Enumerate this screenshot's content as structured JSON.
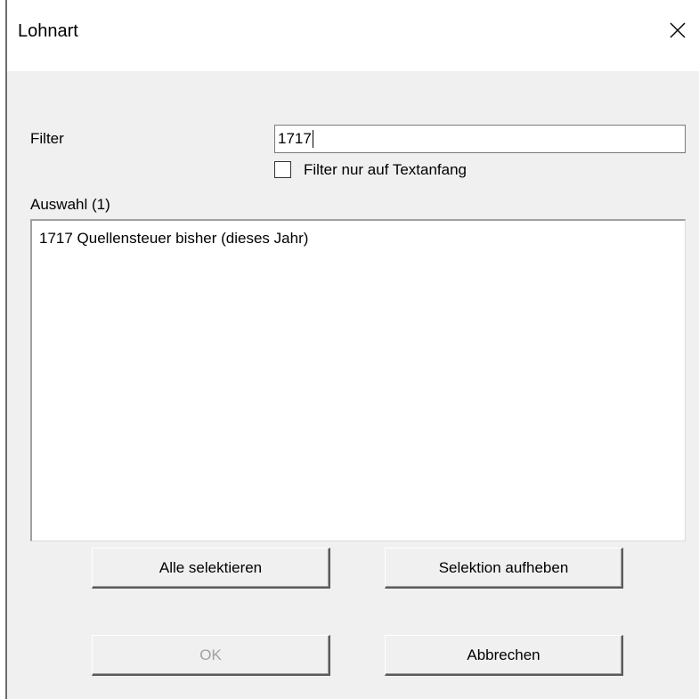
{
  "window": {
    "title": "Lohnart",
    "close_icon": "close-icon"
  },
  "filter": {
    "label": "Filter",
    "value": "1717",
    "checkbox_label": "Filter nur auf Textanfang",
    "checkbox_checked": false
  },
  "selection": {
    "label": "Auswahl (1)",
    "items": [
      "1717 Quellensteuer bisher (dieses Jahr)"
    ]
  },
  "buttons": {
    "select_all": "Alle selektieren",
    "clear_selection": "Selektion aufheben",
    "ok": "OK",
    "cancel": "Abbrechen"
  },
  "colors": {
    "dialog_bg": "#f0f0f0",
    "titlebar_bg": "#ffffff",
    "disabled_text": "#a0a0a0"
  }
}
